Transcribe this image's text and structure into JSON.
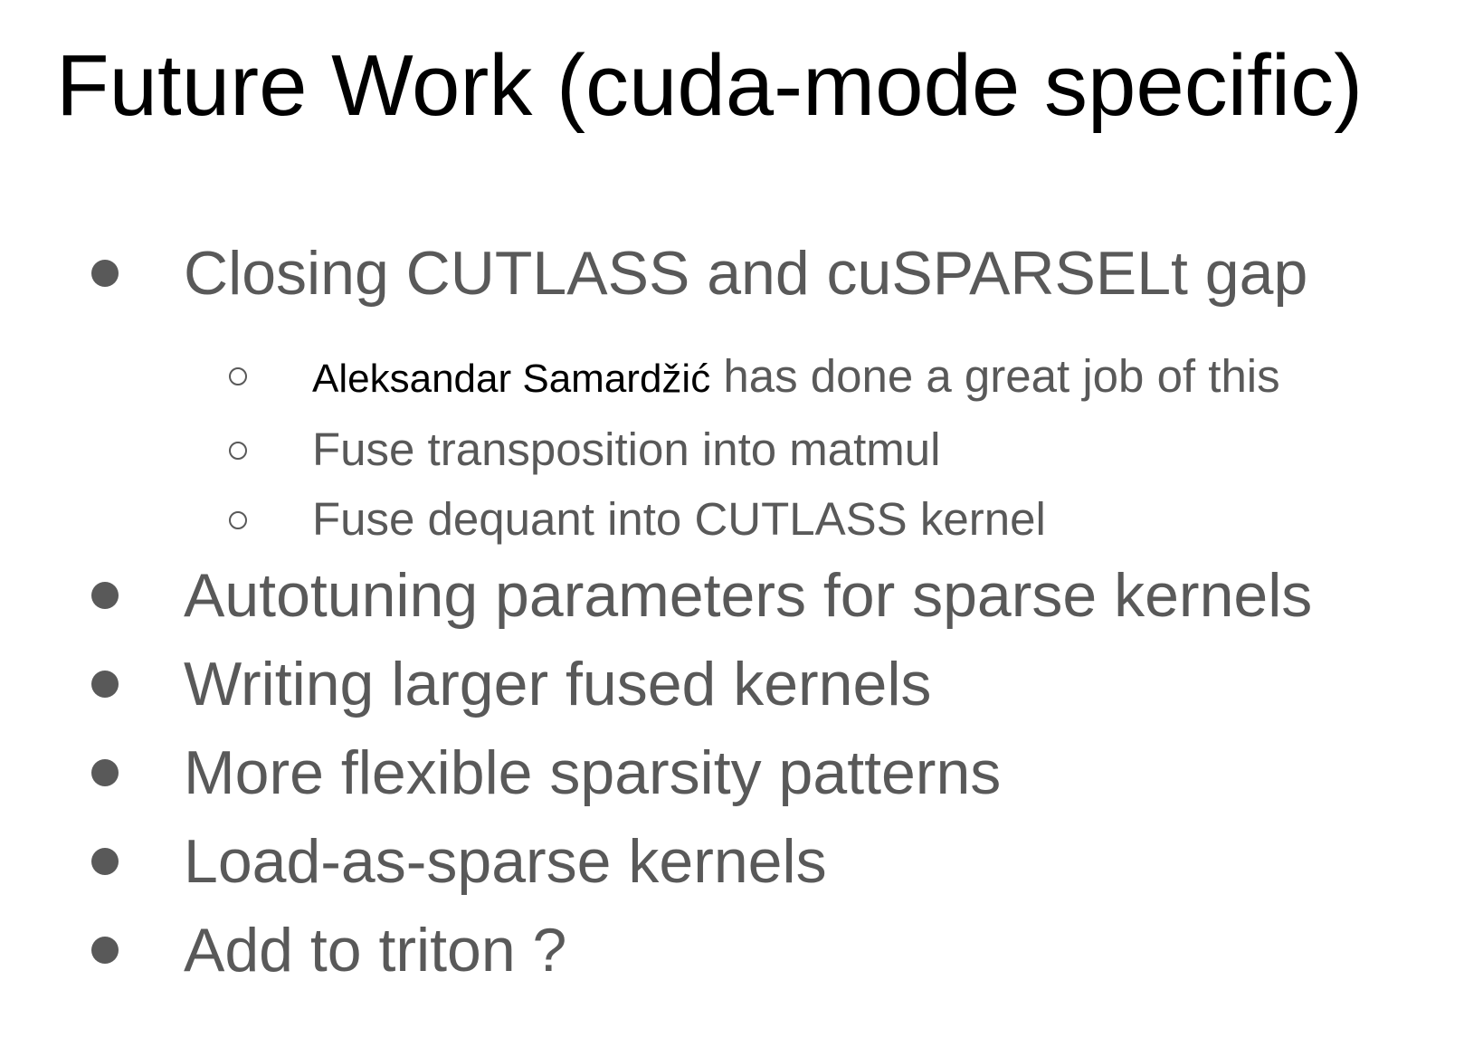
{
  "slide": {
    "title": "Future Work (cuda-mode specific)",
    "bullets": [
      {
        "text": "Closing CUTLASS and cuSPARSELt gap"
      },
      {
        "text": "Autotuning parameters for sparse kernels"
      },
      {
        "text": "Writing larger fused kernels"
      },
      {
        "text": "More flexible sparsity patterns"
      },
      {
        "text": "Load-as-sparse kernels"
      },
      {
        "text": "Add to triton ?"
      }
    ],
    "sub_bullets": [
      {
        "name": "Aleksandar Samardžić",
        "text": " has done a great job of this"
      },
      {
        "text": "Fuse transposition into matmul"
      },
      {
        "text": "Fuse dequant into CUTLASS kernel"
      }
    ]
  },
  "colors": {
    "title": "#000000",
    "body_text": "#595959",
    "background": "#ffffff"
  }
}
